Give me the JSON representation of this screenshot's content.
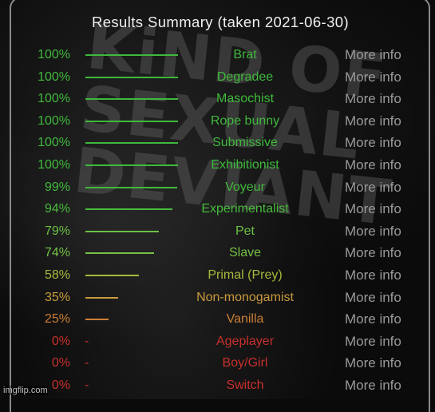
{
  "title": "Results Summary (taken 2021-06-30)",
  "more_info_label": "More info",
  "watermark": "imgflip.com",
  "colors": {
    "green": "#3fb93c",
    "light_green": "#73c244",
    "yellow_green": "#a9b93c",
    "orange": "#c98f3a",
    "dark_orange": "#cc7a35",
    "red": "#c8302d",
    "more_info": "#9a9a9a",
    "title": "#f0f0f0",
    "border": "#8a8a8a"
  },
  "results": [
    {
      "percent": 100,
      "label": "100%",
      "name": "Brat",
      "color": "#3fb93c"
    },
    {
      "percent": 100,
      "label": "100%",
      "name": "Degradee",
      "color": "#3fb93c"
    },
    {
      "percent": 100,
      "label": "100%",
      "name": "Masochist",
      "color": "#3fb93c"
    },
    {
      "percent": 100,
      "label": "100%",
      "name": "Rope bunny",
      "color": "#3fb93c"
    },
    {
      "percent": 100,
      "label": "100%",
      "name": "Submissive",
      "color": "#3fb93c"
    },
    {
      "percent": 100,
      "label": "100%",
      "name": "Exhibitionist",
      "color": "#3fb93c"
    },
    {
      "percent": 99,
      "label": "99%",
      "name": "Voyeur",
      "color": "#41b93c"
    },
    {
      "percent": 94,
      "label": "94%",
      "name": "Experimentalist",
      "color": "#48bb3c"
    },
    {
      "percent": 79,
      "label": "79%",
      "name": "Pet",
      "color": "#6cc044"
    },
    {
      "percent": 74,
      "label": "74%",
      "name": "Slave",
      "color": "#76c046"
    },
    {
      "percent": 58,
      "label": "58%",
      "name": "Primal (Prey)",
      "color": "#a9b93c"
    },
    {
      "percent": 35,
      "label": "35%",
      "name": "Non-monogamist",
      "color": "#c99a3c"
    },
    {
      "percent": 25,
      "label": "25%",
      "name": "Vanilla",
      "color": "#cc7f35"
    },
    {
      "percent": 0,
      "label": "0%",
      "name": "Ageplayer",
      "color": "#c8302d"
    },
    {
      "percent": 0,
      "label": "0%",
      "name": "Boy/Girl",
      "color": "#c8302d"
    },
    {
      "percent": 0,
      "label": "0%",
      "name": "Switch",
      "color": "#c8302d"
    }
  ],
  "background_text": [
    "KiND OF",
    "SEXUAL",
    "DEVIANT"
  ],
  "zero_marker": "-"
}
